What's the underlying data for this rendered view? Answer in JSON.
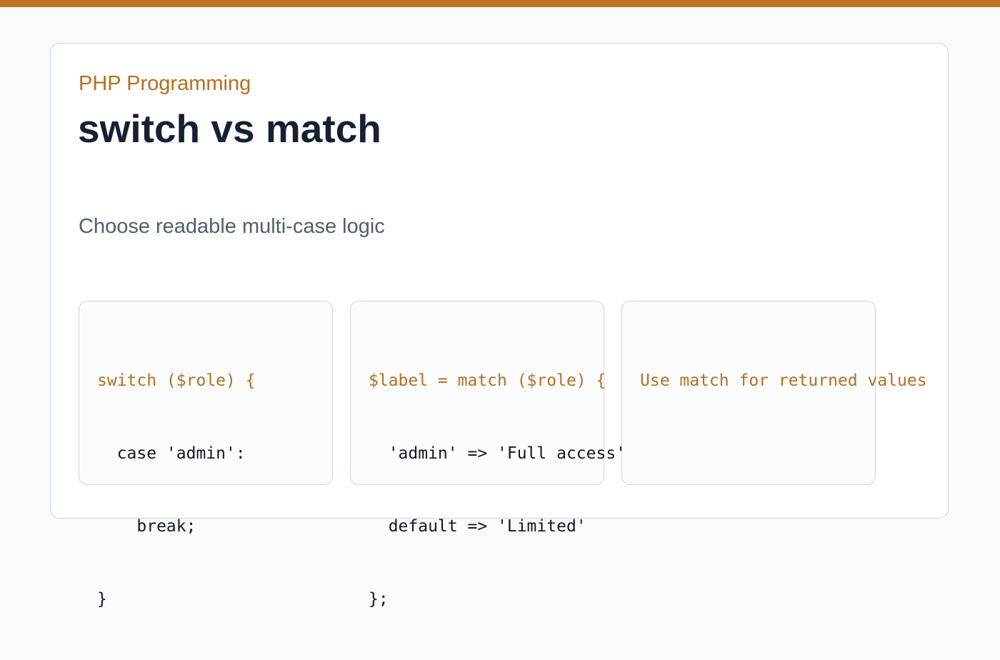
{
  "header": {
    "eyebrow": "PHP Programming",
    "title": "switch vs match",
    "subtitle": "Choose readable multi-case logic"
  },
  "cards": [
    {
      "lines": [
        "switch ($role) {",
        "  case 'admin':",
        "    break;",
        "}"
      ]
    },
    {
      "lines": [
        "$label = match ($role) {",
        "  'admin' => 'Full access',",
        "  default => 'Limited'",
        "};"
      ]
    },
    {
      "lines": [
        "Use match for returned values"
      ]
    }
  ],
  "colors": {
    "accent": "#c07422",
    "accent_text": "#b86e1f",
    "title": "#162032",
    "subtitle": "#525e6e",
    "border": "#cdd3df",
    "background": "#f8fafc"
  }
}
